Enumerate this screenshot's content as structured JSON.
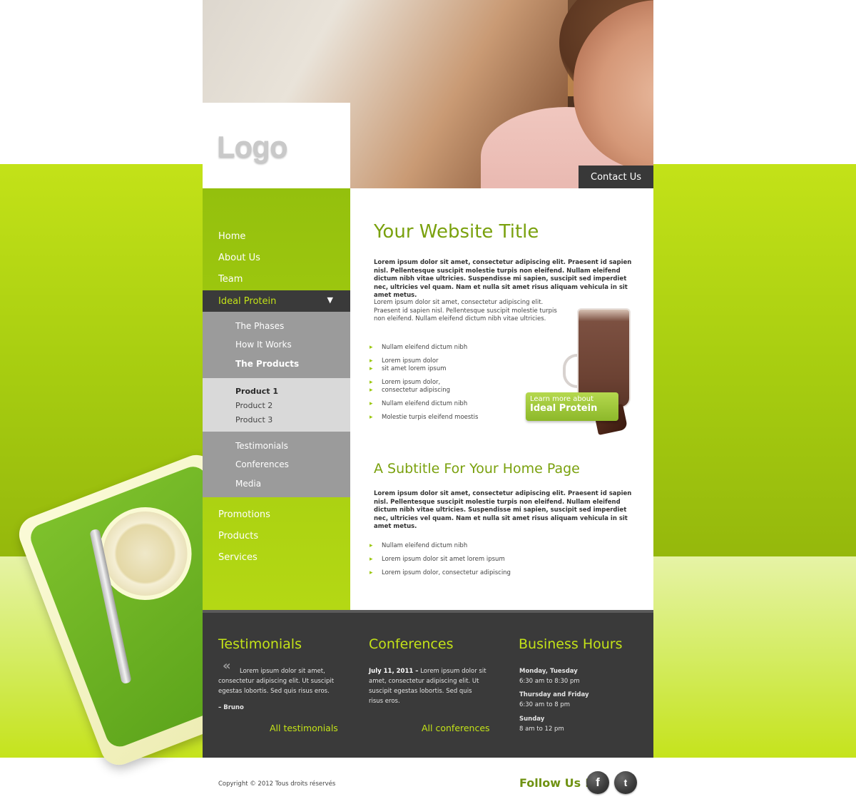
{
  "brand": {
    "logo": "Logo",
    "accent": "#c3e218",
    "dark": "#3a3a3a"
  },
  "header": {
    "contact_label": "Contact Us"
  },
  "nav": {
    "top_items": [
      "Home",
      "About Us",
      "Team"
    ],
    "active": "Ideal Protein",
    "sub_items": [
      "The Phases",
      "How It Works",
      "The Products"
    ],
    "products": [
      "Product 1",
      "Product 2",
      "Product 3"
    ],
    "sub_items2": [
      "Testimonials",
      "Conferences",
      "Media"
    ],
    "bottom_items": [
      "Promotions",
      "Products",
      "Services"
    ]
  },
  "main": {
    "title": "Your Website Title",
    "lead": "Lorem ipsum dolor sit amet, consectetur adipiscing elit. Praesent id sapien nisl. Pellentesque suscipit molestie turpis non eleifend. Nullam eleifend dictum nibh vitae ultricies. Suspendisse mi sapien, suscipit sed imperdiet nec, ultricies vel quam. Nam et nulla sit amet risus aliquam vehicula in sit amet metus.",
    "para": "Lorem ipsum dolor sit amet, consectetur adipiscing elit. Praesent id sapien nisl. Pellentesque suscipit molestie turpis non eleifend. Nullam eleifend dictum nibh vitae ultricies.",
    "bullets": [
      "Nullam eleifend dictum nibh",
      "Lorem ipsum dolor",
      "sit amet lorem ipsum",
      "Lorem ipsum dolor,",
      "consectetur adipiscing",
      "Nullam eleifend dictum nibh",
      "Molestie turpis eleifend moestis"
    ],
    "promo_line1": "Learn more about",
    "promo_line2": "Ideal Protein",
    "subtitle": "A Subtitle For Your Home Page",
    "lead2": "Lorem ipsum dolor sit amet, consectetur adipiscing elit. Praesent id sapien nisl. Pellentesque suscipit molestie turpis non eleifend. Nullam eleifend dictum nibh vitae ultricies. Suspendisse mi sapien, suscipit sed imperdiet nec, ultricies vel quam. Nam et nulla sit amet risus aliquam vehicula in sit amet metus.",
    "bullets2": [
      "Nullam eleifend dictum nibh",
      "Lorem ipsum dolor sit amet lorem ipsum",
      "Lorem ipsum dolor, consectetur adipiscing"
    ]
  },
  "footer_cols": {
    "testimonials": {
      "title": "Testimonials",
      "text": "Lorem ipsum dolor sit amet, consectetur adipiscing elit. Ut suscipit egestas lobortis. Sed quis risus eros.",
      "author": "– Bruno",
      "link": "All testimonials"
    },
    "conferences": {
      "title": "Conferences",
      "date": "July 11, 2011 –",
      "text": "Lorem ipsum dolor sit amet, consectetur adipiscing elit. Ut suscipit egestas lobortis. Sed quis risus eros.",
      "link": "All conferences"
    },
    "hours": {
      "title": "Business Hours",
      "rows": [
        {
          "day": "Monday, Tuesday",
          "time": "6:30 am to 8:30 pm"
        },
        {
          "day": "Thursday and Friday",
          "time": "6:30 am to 8 pm"
        },
        {
          "day": "Sunday",
          "time": "8 am to 12 pm"
        }
      ]
    }
  },
  "footer": {
    "copyright": "Copyright © 2012 Tous droits réservés",
    "follow": "Follow Us !",
    "facebook_glyph": "f",
    "twitter_glyph": "t"
  }
}
